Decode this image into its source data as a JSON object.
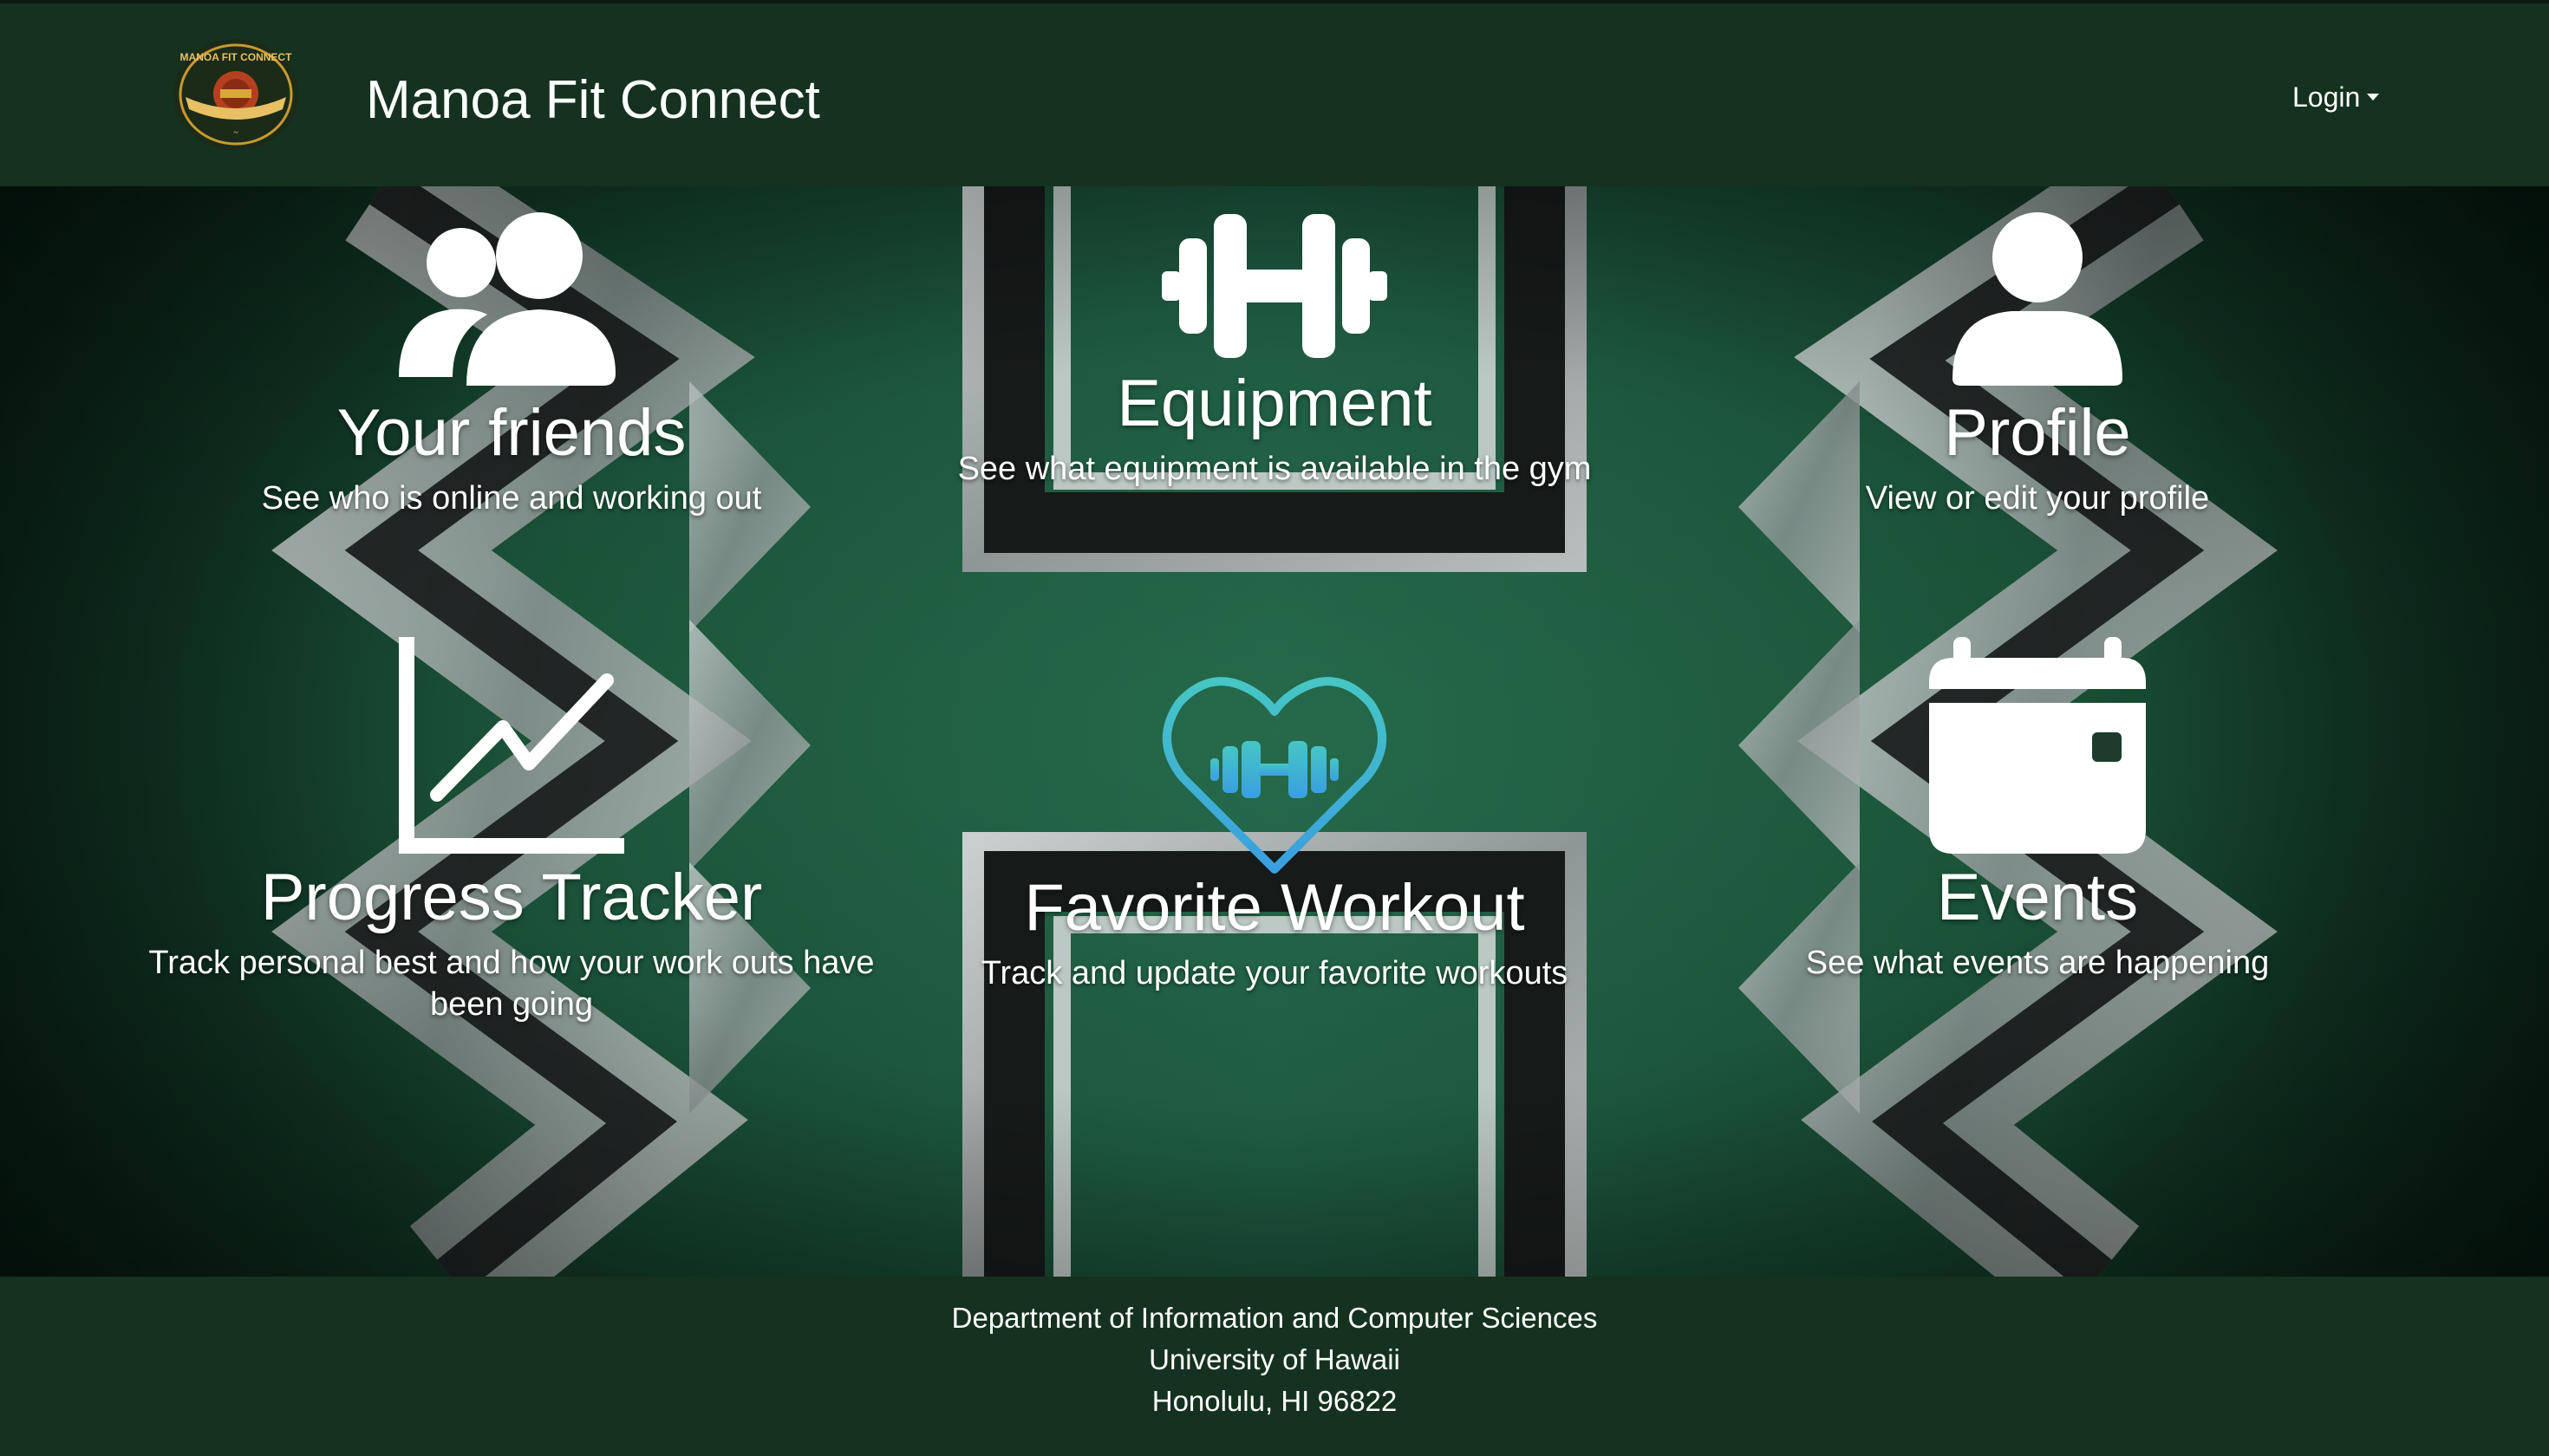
{
  "navbar": {
    "brand": "Manoa Fit Connect",
    "logo_icon": "manoa-fit-connect-logo",
    "logo_text": "MANOA FIT CONNECT",
    "login_label": "Login",
    "background": "#14321f"
  },
  "tiles": [
    {
      "title": "Your friends",
      "desc": "See who is online and working out",
      "icon": "user-group-icon"
    },
    {
      "title": "Equipment",
      "desc": "See what equipment is available in the gym",
      "icon": "dumbbell-icon"
    },
    {
      "title": "Profile",
      "desc": "View or edit your profile",
      "icon": "user-icon"
    },
    {
      "title": "Progress Tracker",
      "desc": "Track personal best and how your work outs have been going",
      "icon": "chart-line-icon"
    },
    {
      "title": "Favorite Workout",
      "desc": "Track and update your favorite workouts",
      "icon": "heart-dumbbell-icon"
    },
    {
      "title": "Events",
      "desc": "See what events are happening",
      "icon": "calendar-icon"
    }
  ],
  "footer": {
    "line1": "Department of Information and Computer Sciences",
    "line2": "University of Hawaii",
    "line3": "Honolulu, HI 96822"
  },
  "colors": {
    "nav_bg": "#14321f",
    "hero_green": "#23644a",
    "favorite_icon": "#4cc3d9"
  }
}
